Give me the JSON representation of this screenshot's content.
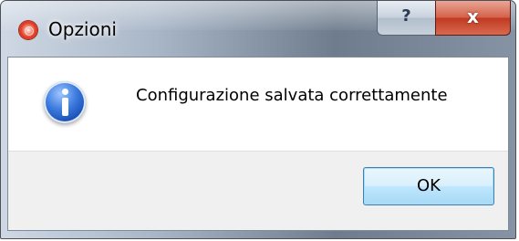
{
  "window": {
    "title": "Opzioni",
    "app_icon": "app-icon"
  },
  "caption": {
    "help_label": "?",
    "close_label": "x",
    "help_icon": "question-icon",
    "close_icon": "close-icon"
  },
  "dialog": {
    "icon": "info-icon",
    "message": "Configurazione salvata correttamente",
    "ok_label": "OK"
  },
  "colors": {
    "close_button": "#c13a22",
    "ok_button_border": "#3c7fb1",
    "info_icon": "#0b3fa8"
  }
}
